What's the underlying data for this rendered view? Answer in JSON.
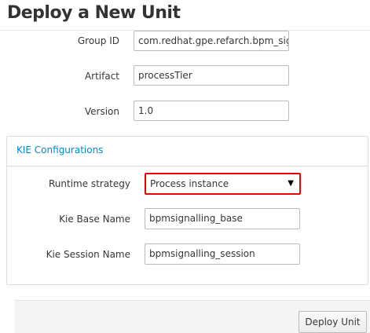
{
  "title": "Deploy a New Unit",
  "fields": {
    "group_id": {
      "label": "Group ID",
      "value": "com.redhat.gpe.refarch.bpm_sig"
    },
    "artifact": {
      "label": "Artifact",
      "value": "processTier"
    },
    "version": {
      "label": "Version",
      "value": "1.0"
    }
  },
  "kie": {
    "heading": "KIE Configurations",
    "runtime_strategy": {
      "label": "Runtime strategy",
      "value": "Process instance"
    },
    "kie_base": {
      "label": "Kie Base Name",
      "value": "bpmsignalling_base"
    },
    "kie_session": {
      "label": "Kie Session Name",
      "value": "bpmsignalling_session"
    }
  },
  "footer": {
    "deploy_label": "Deploy Unit"
  }
}
